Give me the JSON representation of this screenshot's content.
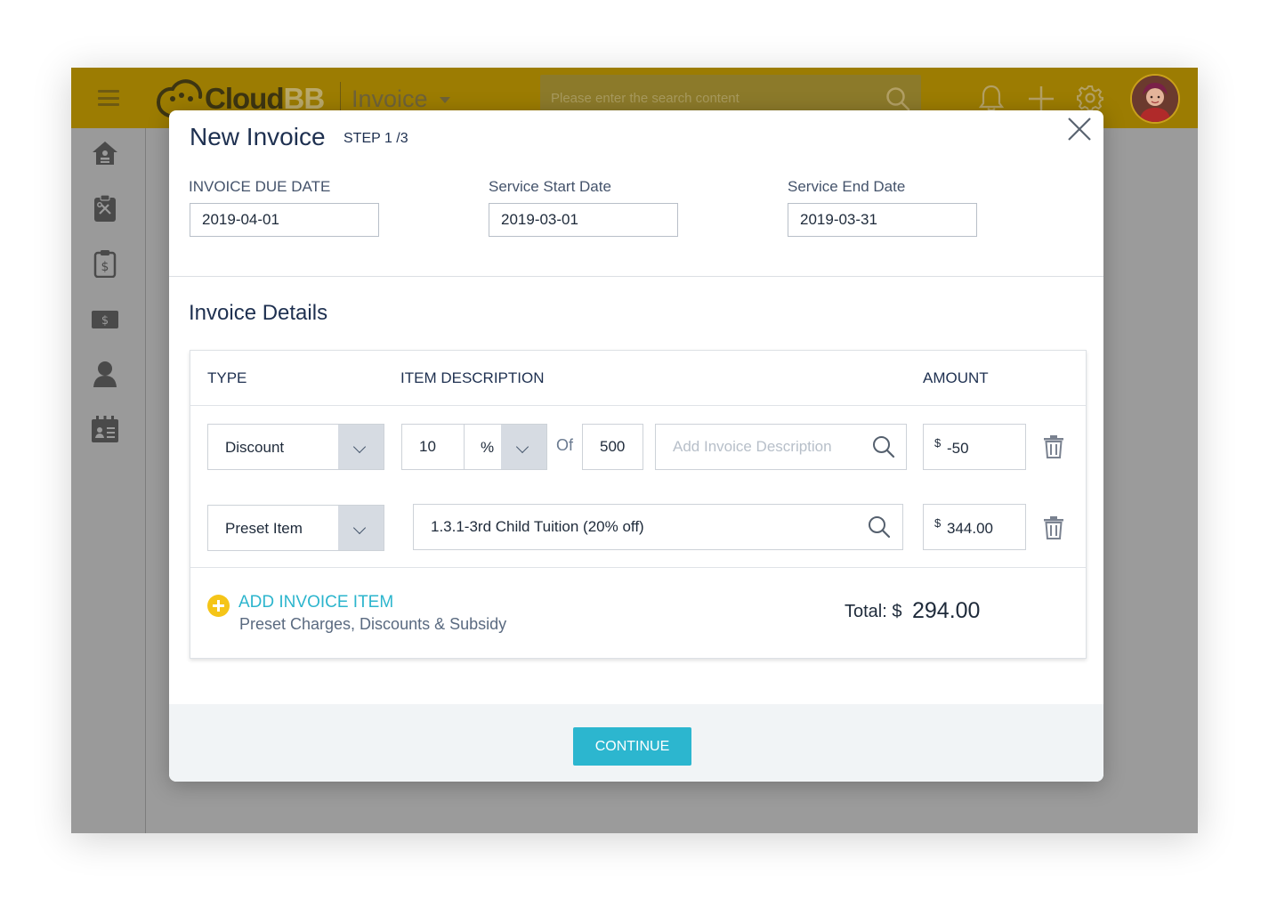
{
  "header": {
    "logo_main": "Cloud",
    "logo_accent": "BB",
    "module_title": "Invoice",
    "search_placeholder": "Please enter the search content",
    "icons": [
      "bell-icon",
      "plus-icon",
      "gear-icon"
    ]
  },
  "sidebar": {
    "items": [
      {
        "icon": "home-icon"
      },
      {
        "icon": "tools-clipboard-icon"
      },
      {
        "icon": "invoice-clipboard-icon"
      },
      {
        "icon": "money-bill-icon"
      },
      {
        "icon": "user-icon"
      },
      {
        "icon": "calendar-id-icon"
      }
    ]
  },
  "modal": {
    "title": "New Invoice",
    "step": "STEP 1 /3",
    "fields": {
      "due_date": {
        "label": "INVOICE DUE DATE",
        "value": "2019-04-01"
      },
      "start_date": {
        "label": "Service Start Date",
        "value": "2019-03-01"
      },
      "end_date": {
        "label": "Service End Date",
        "value": "2019-03-31"
      }
    },
    "section_title": "Invoice Details",
    "table": {
      "headers": {
        "type": "TYPE",
        "description": "ITEM DESCRIPTION",
        "amount": "AMOUNT"
      },
      "rows": [
        {
          "type": "Discount",
          "discount_value": "10",
          "discount_unit": "%",
          "of_label": "Of",
          "of_value": "500",
          "description_placeholder": "Add Invoice Description",
          "currency": "$",
          "amount": "-50"
        },
        {
          "type": "Preset Item",
          "description": "1.3.1-3rd Child Tuition (20% off)",
          "currency": "$",
          "amount": "344.00"
        }
      ]
    },
    "add_item": {
      "label": "ADD INVOICE ITEM",
      "sub": "Preset Charges, Discounts & Subsidy"
    },
    "total": {
      "label": "Total: $",
      "value": "294.00"
    },
    "continue_label": "CONTINUE"
  },
  "colors": {
    "topbar": "#9c7c02",
    "accent": "#2cb6cf",
    "add_circle": "#f5c518",
    "overlay": "#9b9b9b"
  }
}
